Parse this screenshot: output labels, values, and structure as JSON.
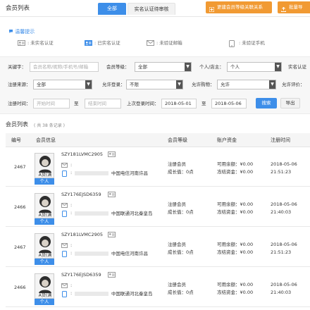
{
  "header": {
    "title": "会员列表",
    "tabs": [
      {
        "label": "全部"
      },
      {
        "label": "实名认证待审核"
      }
    ],
    "buttons": [
      {
        "label": "更建会员等级关联关系"
      },
      {
        "label": "批量导"
      }
    ]
  },
  "tips": {
    "title": "温馨提示",
    "items": [
      {
        "label": ": 未实名认证"
      },
      {
        "label": ": 已实名认证"
      },
      {
        "label": ": 未验证邮箱"
      },
      {
        "label": ": 未验证手机"
      }
    ]
  },
  "filters": {
    "keyword_label": "关键字：",
    "keyword_placeholder": "会员名称/昵称/手机号/邮箱",
    "level_label": "会员等级：",
    "level_value": "全部",
    "type_label": "个人/店主：",
    "type_value": "个人",
    "verify_label": "实名认证",
    "source_label": "注册来源：",
    "source_value": "全部",
    "login_label": "允许登录：",
    "login_value": "不限",
    "buy_label": "允许购物：",
    "buy_value": "允许",
    "eval_label": "允许评价：",
    "regtime_label": "注册时间：",
    "start_placeholder": "开始时间",
    "to_label": "至",
    "end_placeholder": "结束时间",
    "lastlogin_label": "上次登录时间：",
    "lastlogin_start": "2018-05-01",
    "lastlogin_to": "至",
    "lastlogin_end": "2018-05-06",
    "search_label": "搜索",
    "export_label": "导出"
  },
  "list": {
    "title": "会员列表",
    "count_text": "( 共 38 条记录 )",
    "columns": [
      "编号",
      "会员信息",
      "会员等级",
      "账户资金",
      "注册时间"
    ],
    "rows": [
      {
        "id": "2467",
        "name": "SZY181LVMC2905",
        "phone_prefix": ":",
        "carrier": "中国电信河南许昌",
        "avatar_label": "A货(满",
        "badge": "个人",
        "level": "注册会员",
        "growth": "成长值：0点",
        "available": "可用余额：¥0.00",
        "frozen": "冻结资金：¥0.00",
        "date": "2018-05-06",
        "time": "21:51:23"
      },
      {
        "id": "2466",
        "name": "SZY176EJSD6359",
        "phone_prefix": ":",
        "carrier": "中国联通河北秦皇岛",
        "avatar_label": "A货(满",
        "badge": "个人",
        "level": "注册会员",
        "growth": "成长值：0点",
        "available": "可用余额：¥0.00",
        "frozen": "冻结资金：¥0.00",
        "date": "2018-05-06",
        "time": "21:40:03"
      },
      {
        "id": "2467",
        "name": "SZY181LVMC2905",
        "phone_prefix": ":",
        "carrier": "中国电信河南许昌",
        "avatar_label": "A货(满",
        "badge": "个人",
        "level": "注册会员",
        "growth": "成长值：0点",
        "available": "可用余额：¥0.00",
        "frozen": "冻结资金：¥0.00",
        "date": "2018-05-06",
        "time": "21:51:23"
      },
      {
        "id": "2466",
        "name": "SZY176EJSD6359",
        "phone_prefix": ":",
        "carrier": "中国联通河北秦皇岛",
        "avatar_label": "A货(满",
        "badge": "个人",
        "level": "注册会员",
        "growth": "成长值：0点",
        "available": "可用余额：¥0.00",
        "frozen": "冻结资金：¥0.00",
        "date": "2018-05-06",
        "time": "21:40:03"
      }
    ]
  },
  "colors": {
    "accent": "#3d8ee9",
    "orange": "#f19a33"
  },
  "icons": [
    "tip-icon",
    "id-card-grey-icon",
    "id-card-blue-icon",
    "mail-icon",
    "phone-icon",
    "user-card-icon",
    "expand-icon"
  ]
}
